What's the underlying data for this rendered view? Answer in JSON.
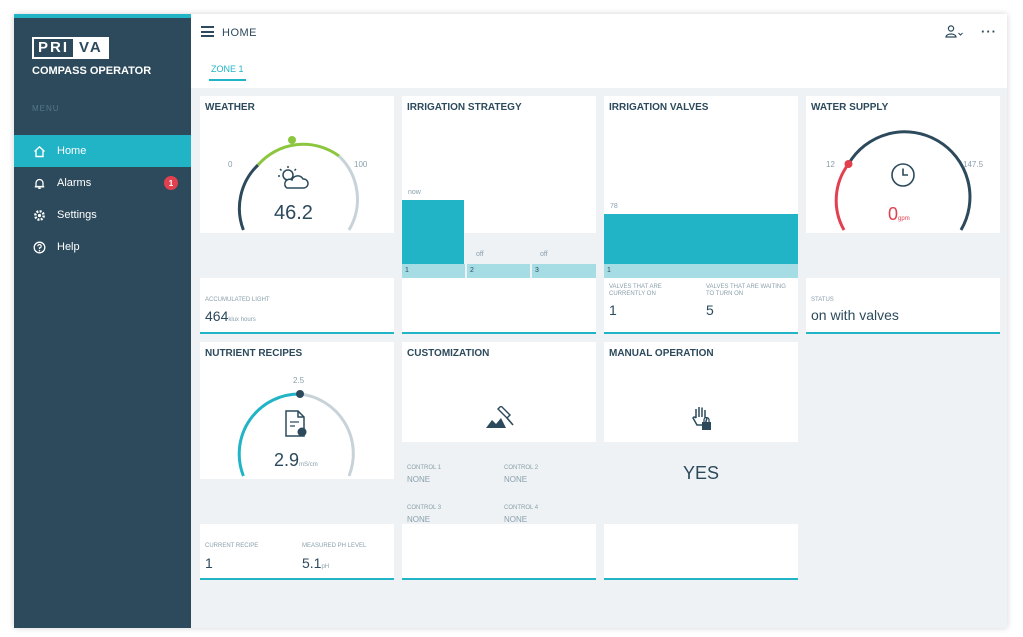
{
  "brand": {
    "logo_a": "PRI",
    "logo_b": "VA",
    "app_name": "COMPASS OPERATOR",
    "section": "MENU"
  },
  "nav": [
    {
      "label": "Home",
      "icon": "home-icon"
    },
    {
      "label": "Alarms",
      "icon": "bell-icon",
      "badge": "1"
    },
    {
      "label": "Settings",
      "icon": "gear-icon"
    },
    {
      "label": "Help",
      "icon": "help-icon"
    }
  ],
  "topbar": {
    "title": "HOME",
    "tab": "ZONE 1"
  },
  "weather": {
    "title": "WEATHER",
    "value": "46.2",
    "min": "0",
    "max": "100",
    "acc_label": "ACCUMULATED LIGHT",
    "acc_value": "464",
    "acc_unit": "klux hours"
  },
  "irrigation_strategy": {
    "title": "IRRIGATION STRATEGY",
    "bars": [
      {
        "label": "now",
        "axis": "1"
      },
      {
        "label": "off",
        "axis": "2"
      },
      {
        "label": "off",
        "axis": "3"
      }
    ]
  },
  "irrigation_valves": {
    "title": "IRRIGATION VALVES",
    "bar_label": "78",
    "axis": "1",
    "label_a": "VALVES THAT ARE CURRENTLY ON",
    "value_a": "1",
    "label_b": "VALVES THAT ARE WAITING TO TURN ON",
    "value_b": "5"
  },
  "water_supply": {
    "title": "WATER SUPPLY",
    "min": "12",
    "max": "147.5",
    "value": "0",
    "unit": "gpm",
    "status_label": "STATUS",
    "status_value": "on with valves"
  },
  "nutrient": {
    "title": "NUTRIENT RECIPES",
    "target": "2.5",
    "value": "2.9",
    "unit": "mS/cm",
    "recipe_label": "CURRENT RECIPE",
    "recipe_value": "1",
    "level_label": "MEASURED PH LEVEL",
    "level_value": "5.1",
    "level_unit": "pH"
  },
  "customization": {
    "title": "CUSTOMIZATION",
    "controls": [
      {
        "label": "CONTROL 1",
        "value": "NONE"
      },
      {
        "label": "CONTROL 2",
        "value": "NONE"
      },
      {
        "label": "CONTROL 3",
        "value": "NONE"
      },
      {
        "label": "CONTROL 4",
        "value": "NONE"
      }
    ]
  },
  "manual": {
    "title": "MANUAL OPERATION",
    "value": "YES"
  },
  "colors": {
    "accent": "#20b4c6",
    "sidebar": "#2c4a5c",
    "alert": "#e2404f",
    "green": "#8cc63f"
  }
}
